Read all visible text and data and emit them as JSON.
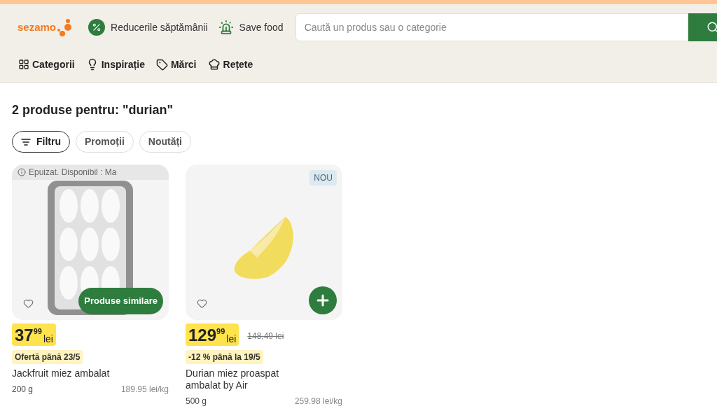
{
  "header": {
    "logo": "sezamo",
    "links": [
      {
        "label": "Reducerile săptămânii"
      },
      {
        "label": "Save food"
      }
    ],
    "search": {
      "placeholder": "Caută un produs sau o categorie"
    },
    "nav": [
      {
        "label": "Categorii"
      },
      {
        "label": "Inspirație"
      },
      {
        "label": "Mărci"
      },
      {
        "label": "Rețete"
      }
    ]
  },
  "results": {
    "title": "2 produse pentru: \"durian\"",
    "filters": [
      {
        "label": "Filtru",
        "kind": "filter",
        "selected": true
      },
      {
        "label": "Promoții",
        "kind": "chip",
        "selected": false
      },
      {
        "label": "Noutăți",
        "kind": "chip",
        "selected": false
      }
    ],
    "products": [
      {
        "name": "Jackfruit miez ambalat",
        "sold_out": true,
        "notice": "Epuizat. Disponibil : Ma",
        "action": {
          "kind": "similar",
          "label": "Produse similare"
        },
        "price_int": "37",
        "price_cents": "99",
        "currency": "lei",
        "promo": "Ofertă până 23/5",
        "quantity": "200 g",
        "unit_price": "189.95 lei/kg"
      },
      {
        "name": "Durian miez proaspat ambalat by Air",
        "sold_out": false,
        "badge": "NOU",
        "action": {
          "kind": "add"
        },
        "price_int": "129",
        "price_cents": "99",
        "currency": "lei",
        "old_price": "148,49 lei",
        "promo": "-12 % până la 19/5",
        "quantity": "500 g",
        "unit_price": "259.98 lei/kg"
      }
    ]
  }
}
